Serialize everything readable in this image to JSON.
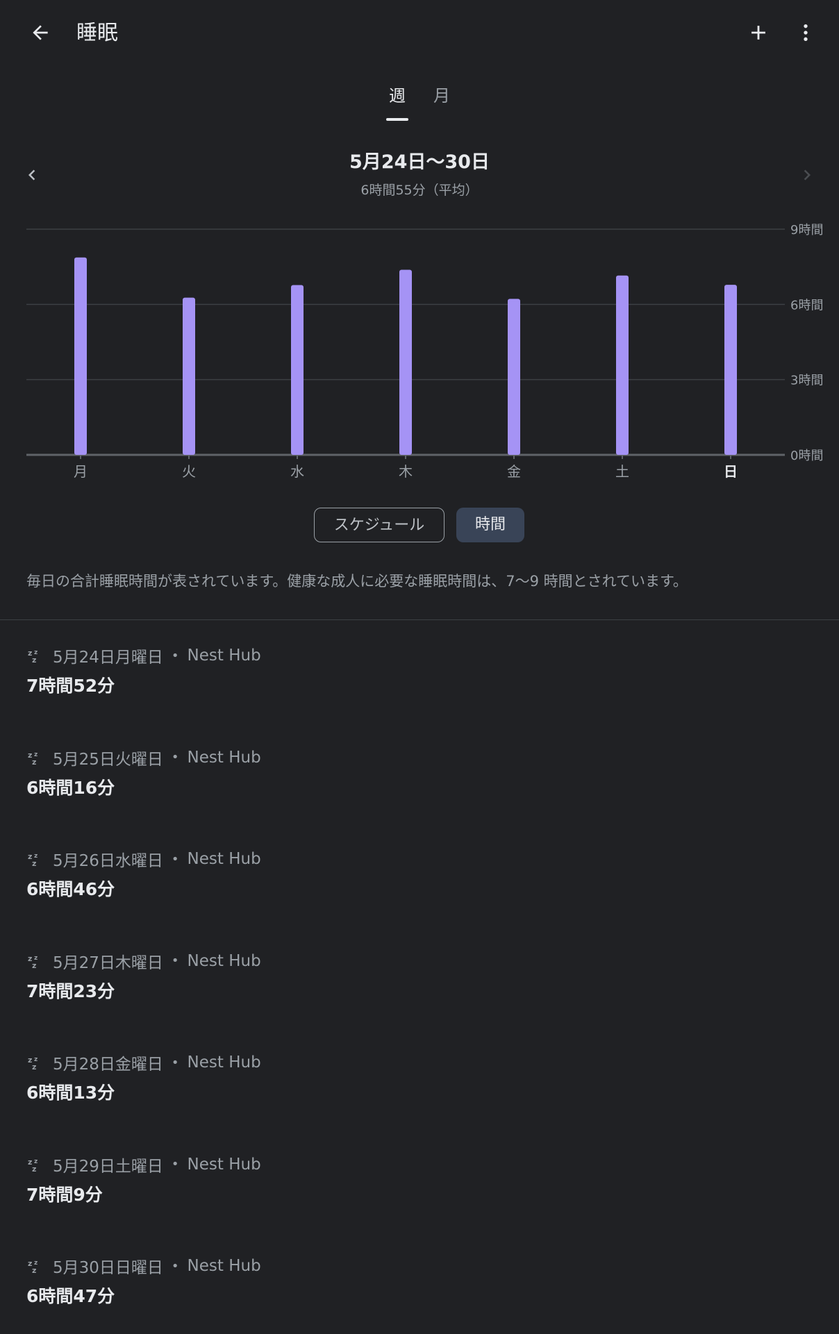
{
  "header": {
    "title": "睡眠",
    "back_icon": "arrow-back-icon",
    "add_icon": "plus-icon",
    "more_icon": "more-vert-icon"
  },
  "tabs": [
    {
      "label": "週",
      "selected": true
    },
    {
      "label": "月",
      "selected": false
    }
  ],
  "range": {
    "title": "5月24日〜30日",
    "average": "6時間55分（平均）"
  },
  "colors": {
    "background": "#202124",
    "bar": "#a593f5",
    "grid": "#3c4043",
    "text_secondary": "#9aa0a6"
  },
  "chart_data": {
    "type": "bar",
    "categories": [
      "月",
      "火",
      "水",
      "木",
      "金",
      "土",
      "日"
    ],
    "highlighted_category": "日",
    "values": [
      7.87,
      6.27,
      6.77,
      7.38,
      6.22,
      7.15,
      6.78
    ],
    "yticks": [
      "0時間",
      "3時間",
      "6時間",
      "9時間"
    ],
    "ylim": [
      0,
      9
    ],
    "title": "",
    "xlabel": "",
    "ylabel": "",
    "grid": true
  },
  "view_toggle": {
    "schedule_label": "スケジュール",
    "duration_label": "時間",
    "selected": "時間"
  },
  "description": "毎日の合計睡眠時間が表されています。健康な成人に必要な睡眠時間は、7〜9 時間とされています。",
  "sessions": [
    {
      "date": "5月24日月曜日",
      "source": "Nest Hub",
      "duration": "7時間52分"
    },
    {
      "date": "5月25日火曜日",
      "source": "Nest Hub",
      "duration": "6時間16分"
    },
    {
      "date": "5月26日水曜日",
      "source": "Nest Hub",
      "duration": "6時間46分"
    },
    {
      "date": "5月27日木曜日",
      "source": "Nest Hub",
      "duration": "7時間23分"
    },
    {
      "date": "5月28日金曜日",
      "source": "Nest Hub",
      "duration": "6時間13分"
    },
    {
      "date": "5月29日土曜日",
      "source": "Nest Hub",
      "duration": "7時間9分"
    },
    {
      "date": "5月30日日曜日",
      "source": "Nest Hub",
      "duration": "6時間47分"
    }
  ],
  "session_separator": "•",
  "session_icon": "sleep-zz-icon"
}
